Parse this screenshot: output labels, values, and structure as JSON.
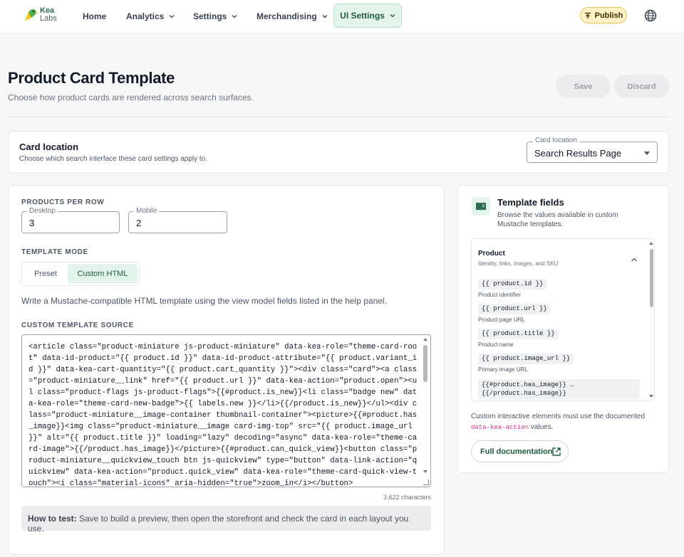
{
  "brand": {
    "name": "Kea",
    "sub": "Labs"
  },
  "nav": {
    "home": "Home",
    "analytics": "Analytics",
    "settings": "Settings",
    "merchandising": "Merchandising",
    "ui_settings": "UI Settings",
    "publish": "Publish"
  },
  "header": {
    "title": "Product Card Template",
    "subtitle": "Choose how product cards are rendered across search surfaces.",
    "save": "Save",
    "discard": "Discard"
  },
  "card_location": {
    "title": "Card location",
    "subtitle": "Choose which search interface these card settings apply to.",
    "select_label": "Card location",
    "select_value": "Search Results Page"
  },
  "editor": {
    "products_per_row_label": "PRODUCTS PER ROW",
    "desktop_label": "Desktop",
    "desktop_value": "3",
    "mobile_label": "Mobile",
    "mobile_value": "2",
    "template_mode_label": "TEMPLATE MODE",
    "mode_preset": "Preset",
    "mode_custom": "Custom HTML",
    "help": "Write a Mustache-compatible HTML template using the view model fields listed in the help panel.",
    "source_label": "CUSTOM TEMPLATE SOURCE",
    "source": "<article class=\"product-miniature js-product-miniature\" data-kea-role=\"theme-card-root\" data-id-product=\"{{ product.id }}\" data-id-product-attribute=\"{{ product.variant_id }}\" data-kea-cart-quantity=\"{{ product.cart_quantity }}\"><div class=\"card\"><a class=\"product-miniature__link\" href=\"{{ product.url }}\" data-kea-action=\"product.open\"><ul class=\"product-flags js-product-flags\">{{#product.is_new}}<li class=\"badge new\" data-kea-role=\"theme-card-new-badge\">{{ labels.new }}</li>{{/product.is_new}}</ul><div class=\"product-miniature__image-container thumbnail-container\"><picture>{{#product.has_image}}<img class=\"product-miniature__image card-img-top\" src=\"{{ product.image_url }}\" alt=\"{{ product.title }}\" loading=\"lazy\" decoding=\"async\" data-kea-role=\"theme-card-image\">{{/product.has_image}}</picture>{{#product.can_quick_view}}<button class=\"product-miniature__quickview_touch btn js-quickview\" type=\"button\" data-link-action=\"quickview\" data-kea-action=\"product.quick_view\" data-kea-role=\"theme-card-quick-view-touch\"><i class=\"material-icons\" aria-hidden=\"true\">zoom_in</i></button>",
    "char_count": "3,622 characters",
    "howto_label": "How to test:",
    "howto_text": " Save to build a preview, then open the storefront and check the card in each layout you use."
  },
  "template_fields": {
    "title": "Template fields",
    "subtitle": "Browse the values available in custom Mustache templates.",
    "group_title": "Product",
    "group_sub": "Identity, links, images, and SKU",
    "fields": [
      {
        "token": "{{ product.id }}",
        "desc": "Product identifier"
      },
      {
        "token": "{{ product.url }}",
        "desc": "Product page URL"
      },
      {
        "token": "{{ product.title }}",
        "desc": "Product name"
      },
      {
        "token": "{{ product.image_url }}",
        "desc": "Primary image URL"
      }
    ],
    "multi_line_1": "{{#product.has_image}} …",
    "multi_line_2": "{{/product.has_image}}",
    "note_before": "Custom interactive elements must use the documented ",
    "note_code": "data-kea-action",
    "note_after": " values.",
    "doc_button": "Full documentation"
  }
}
